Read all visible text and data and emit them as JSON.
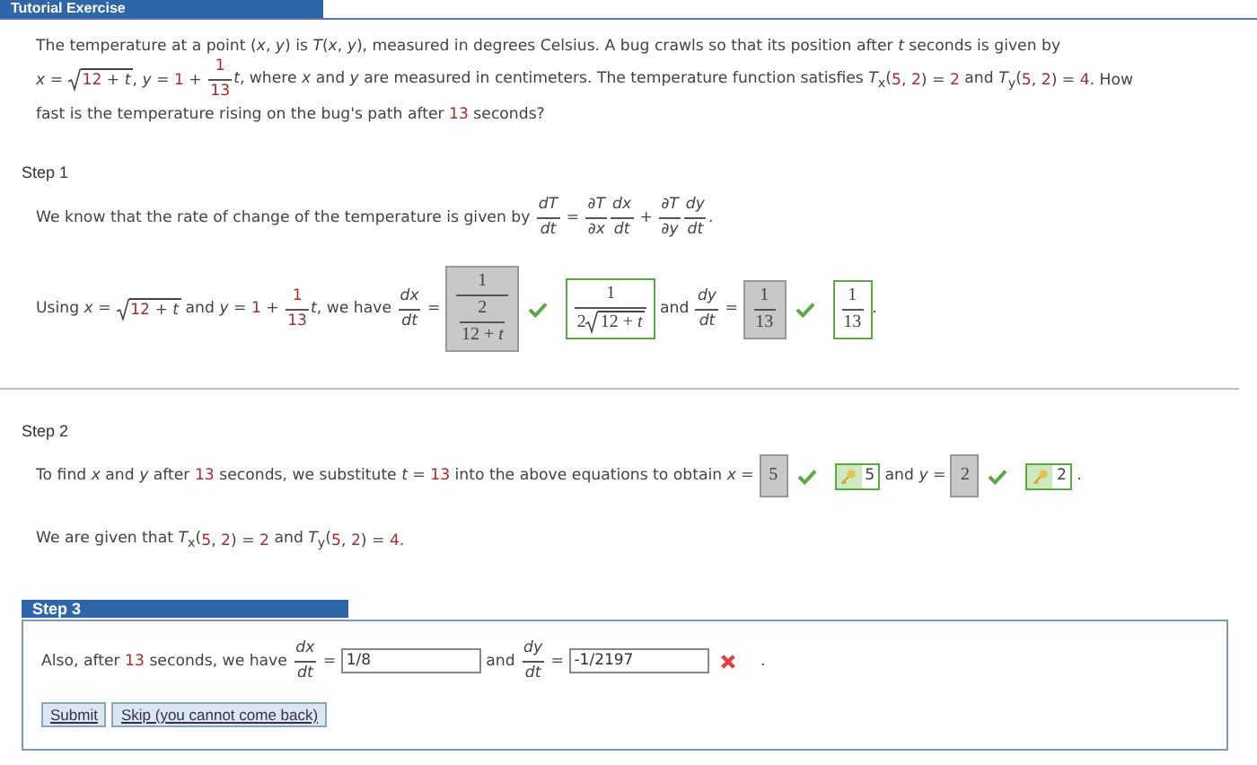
{
  "header": {
    "title": "Tutorial Exercise"
  },
  "intro": [
    [
      {
        "kind": "t",
        "text": "The temperature at a point (*x*, *y*) is *T*(*x*, *y*), measured in degrees Celsius. A bug crawls so that its position after *t* seconds is given by"
      }
    ],
    [
      {
        "kind": "t",
        "text": "*x* = "
      },
      {
        "kind": "sqrt",
        "parts": [
          {
            "kind": "n",
            "text": "12"
          },
          {
            "kind": "t",
            "text": " + *t*"
          }
        ]
      },
      {
        "kind": "t",
        "text": ", *y* = "
      },
      {
        "kind": "n",
        "text": "1"
      },
      {
        "kind": "t",
        "text": " + "
      },
      {
        "kind": "frac",
        "num": [
          {
            "kind": "n",
            "text": "1"
          }
        ],
        "den": [
          {
            "kind": "n",
            "text": "13"
          }
        ]
      },
      {
        "kind": "t",
        "text": "*t*, where *x* and *y* are measured in centimeters. The temperature function satisfies *T*$_{x}$("
      },
      {
        "kind": "n",
        "text": "5"
      },
      {
        "kind": "t",
        "text": ", "
      },
      {
        "kind": "n",
        "text": "2"
      },
      {
        "kind": "t",
        "text": ") = "
      },
      {
        "kind": "n",
        "text": "2"
      },
      {
        "kind": "t",
        "text": " and *T*$_{y}$("
      },
      {
        "kind": "n",
        "text": "5"
      },
      {
        "kind": "t",
        "text": ", "
      },
      {
        "kind": "n",
        "text": "2"
      },
      {
        "kind": "t",
        "text": ") = "
      },
      {
        "kind": "n",
        "text": "4"
      },
      {
        "kind": "t",
        "text": ". How"
      }
    ],
    [
      {
        "kind": "t",
        "text": "fast is the temperature rising on the bug's path after "
      },
      {
        "kind": "n",
        "text": "13"
      },
      {
        "kind": "t",
        "text": " seconds?"
      }
    ]
  ],
  "steps": [
    {
      "label": "Step 1",
      "active": false,
      "lines": [
        [
          {
            "kind": "t",
            "text": "We know that the rate of change of the temperature is given by "
          },
          {
            "kind": "frac",
            "num": [
              {
                "kind": "t",
                "text": "*dT*"
              }
            ],
            "den": [
              {
                "kind": "t",
                "text": "*dt*"
              }
            ]
          },
          {
            "kind": "t",
            "text": " = "
          },
          {
            "kind": "frac",
            "num": [
              {
                "kind": "t",
                "text": "∂*T*"
              }
            ],
            "den": [
              {
                "kind": "t",
                "text": "∂*x*"
              }
            ]
          },
          {
            "kind": "frac",
            "num": [
              {
                "kind": "t",
                "text": "*dx*"
              }
            ],
            "den": [
              {
                "kind": "t",
                "text": "*dt*"
              }
            ]
          },
          {
            "kind": "t",
            "text": " + "
          },
          {
            "kind": "frac",
            "num": [
              {
                "kind": "t",
                "text": "∂*T*"
              }
            ],
            "den": [
              {
                "kind": "t",
                "text": "∂*y*"
              }
            ]
          },
          {
            "kind": "frac",
            "num": [
              {
                "kind": "t",
                "text": "*dy*"
              }
            ],
            "den": [
              {
                "kind": "t",
                "text": "*dt*"
              }
            ]
          },
          {
            "kind": "t",
            "text": "."
          }
        ],
        [
          {
            "kind": "t",
            "text": "Using *x* = "
          },
          {
            "kind": "sqrt",
            "parts": [
              {
                "kind": "n",
                "text": "12"
              },
              {
                "kind": "t",
                "text": " + *t*"
              }
            ]
          },
          {
            "kind": "t",
            "text": " and *y* = "
          },
          {
            "kind": "n",
            "text": "1"
          },
          {
            "kind": "t",
            "text": " + "
          },
          {
            "kind": "frac",
            "num": [
              {
                "kind": "n",
                "text": "1"
              }
            ],
            "den": [
              {
                "kind": "n",
                "text": "13"
              }
            ]
          },
          {
            "kind": "t",
            "text": "*t*, we have "
          },
          {
            "kind": "frac",
            "num": [
              {
                "kind": "t",
                "text": "*dx*"
              }
            ],
            "den": [
              {
                "kind": "t",
                "text": "*dt*"
              }
            ]
          },
          {
            "kind": "t",
            "text": " = "
          },
          {
            "kind": "submitted",
            "content": [
              {
                "kind": "frac",
                "num": [
                  {
                    "kind": "t",
                    "text": "1"
                  }
                ],
                "den": [
                  {
                    "kind": "frac",
                    "num": [
                      {
                        "kind": "t",
                        "text": "2"
                      }
                    ],
                    "den": [
                      {
                        "kind": "t",
                        "text": "12 + *t*"
                      }
                    ]
                  }
                ]
              }
            ]
          },
          {
            "kind": "mark",
            "correct": true
          },
          {
            "kind": "solution",
            "content": [
              {
                "kind": "frac",
                "num": [
                  {
                    "kind": "t",
                    "text": "1"
                  }
                ],
                "den": [
                  {
                    "kind": "t",
                    "text": "2"
                  },
                  {
                    "kind": "sqrt",
                    "parts": [
                      {
                        "kind": "t",
                        "text": "12 + *t*"
                      }
                    ]
                  }
                ]
              }
            ]
          },
          {
            "kind": "t",
            "text": " and "
          },
          {
            "kind": "frac",
            "num": [
              {
                "kind": "t",
                "text": "*dy*"
              }
            ],
            "den": [
              {
                "kind": "t",
                "text": "*dt*"
              }
            ]
          },
          {
            "kind": "t",
            "text": " = "
          },
          {
            "kind": "submitted",
            "content": [
              {
                "kind": "frac",
                "num": [
                  {
                    "kind": "t",
                    "text": "1"
                  }
                ],
                "den": [
                  {
                    "kind": "t",
                    "text": "13"
                  }
                ]
              }
            ]
          },
          {
            "kind": "mark",
            "correct": true
          },
          {
            "kind": "solution",
            "content": [
              {
                "kind": "frac",
                "num": [
                  {
                    "kind": "t",
                    "text": "1"
                  }
                ],
                "den": [
                  {
                    "kind": "t",
                    "text": "13"
                  }
                ]
              }
            ]
          },
          {
            "kind": "t",
            "text": "."
          }
        ]
      ]
    },
    {
      "label": "Step 2",
      "active": false,
      "lines": [
        [
          {
            "kind": "t",
            "text": "To find *x* and *y* after "
          },
          {
            "kind": "n",
            "text": "13"
          },
          {
            "kind": "t",
            "text": " seconds, we substitute *t* = "
          },
          {
            "kind": "n",
            "text": "13"
          },
          {
            "kind": "t",
            "text": " into the above equations to obtain *x* = "
          },
          {
            "kind": "submitted",
            "content": [
              {
                "kind": "t",
                "text": "5"
              }
            ]
          },
          {
            "kind": "mark",
            "correct": true
          },
          {
            "kind": "key",
            "text": "5"
          },
          {
            "kind": "t",
            "text": " and *y* = "
          },
          {
            "kind": "submitted",
            "content": [
              {
                "kind": "t",
                "text": "2"
              }
            ]
          },
          {
            "kind": "mark",
            "correct": true
          },
          {
            "kind": "key",
            "text": "2"
          },
          {
            "kind": "t",
            "text": " ."
          }
        ],
        [
          {
            "kind": "t",
            "text": "We are given that *T*$_{x}$("
          },
          {
            "kind": "n",
            "text": "5"
          },
          {
            "kind": "t",
            "text": ", "
          },
          {
            "kind": "n",
            "text": "2"
          },
          {
            "kind": "t",
            "text": ") = "
          },
          {
            "kind": "n",
            "text": "2"
          },
          {
            "kind": "t",
            "text": " and *T*$_{y}$("
          },
          {
            "kind": "n",
            "text": "5"
          },
          {
            "kind": "t",
            "text": ", "
          },
          {
            "kind": "n",
            "text": "2"
          },
          {
            "kind": "t",
            "text": ") = "
          },
          {
            "kind": "n",
            "text": "4"
          },
          {
            "kind": "t",
            "text": "."
          }
        ]
      ]
    },
    {
      "label": "Step 3",
      "active": true,
      "lines": [
        [
          {
            "kind": "t",
            "text": "Also, after "
          },
          {
            "kind": "n",
            "text": "13"
          },
          {
            "kind": "t",
            "text": " seconds, we have "
          },
          {
            "kind": "frac",
            "num": [
              {
                "kind": "t",
                "text": "*dx*"
              }
            ],
            "den": [
              {
                "kind": "t",
                "text": "*dt*"
              }
            ]
          },
          {
            "kind": "t",
            "text": " = "
          },
          {
            "kind": "input",
            "value": "1/8"
          },
          {
            "kind": "t",
            "text": " and "
          },
          {
            "kind": "frac",
            "num": [
              {
                "kind": "t",
                "text": "*dy*"
              }
            ],
            "den": [
              {
                "kind": "t",
                "text": "*dt*"
              }
            ]
          },
          {
            "kind": "t",
            "text": " = "
          },
          {
            "kind": "input",
            "value": "-1/2197"
          },
          {
            "kind": "mark",
            "correct": false
          },
          {
            "kind": "t",
            "text": " ."
          }
        ]
      ],
      "buttons": [
        "Submit",
        "Skip (you cannot come back)"
      ]
    }
  ]
}
